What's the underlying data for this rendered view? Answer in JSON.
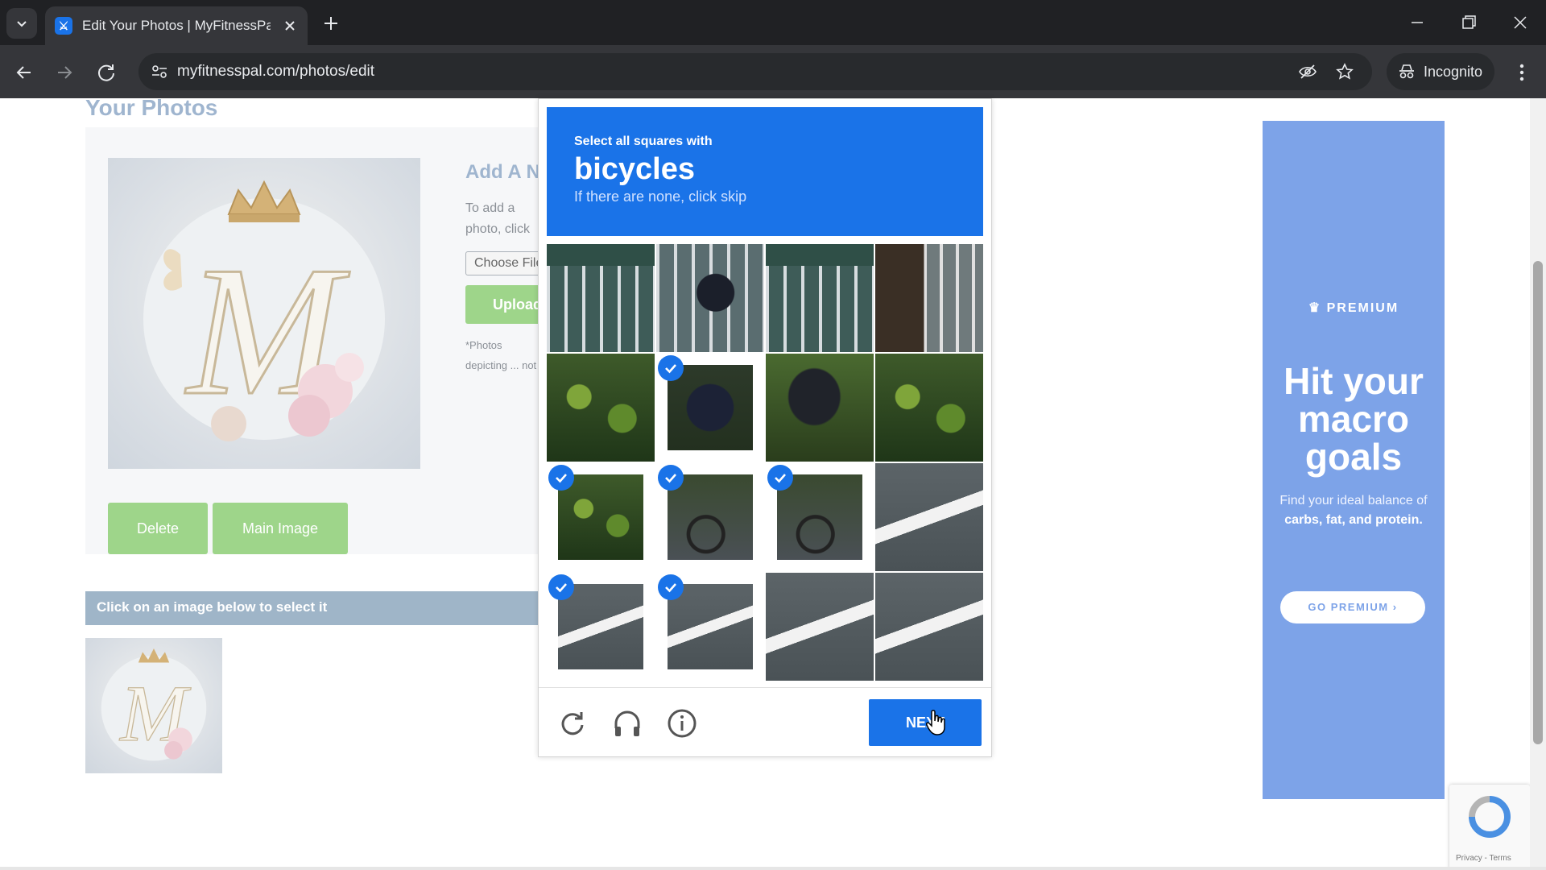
{
  "browser": {
    "tab_title": "Edit Your Photos | MyFitnessPal.com",
    "favicon_letter": "⚔",
    "url": "myfitnesspal.com/photos/edit",
    "incognito_label": "Incognito"
  },
  "page": {
    "title": "Your Photos",
    "add_heading": "Add A New Photo",
    "add_text": "To add a photo, click \"Upload\"",
    "choose_file_label": "Choose File",
    "upload_label": "Upload",
    "note": "*Photos depicting ... not allowed.",
    "delete_label": "Delete",
    "main_image_label": "Main Image",
    "select_bar": "Click on an image below to select it",
    "photo_monogram": "M"
  },
  "ad": {
    "premium_label": "PREMIUM",
    "headline": "Hit your macro goals",
    "sub_prefix": "Find your ideal balance of ",
    "sub_bold": "carbs, fat, and protein.",
    "button_label": "GO PREMIUM"
  },
  "recaptcha": {
    "links": "Privacy - Terms"
  },
  "captcha": {
    "instruction": "Select all squares with",
    "target": "bicycles",
    "hint": "If there are none, click skip",
    "next_label": "NEXT",
    "selected_tiles": [
      5,
      8,
      9,
      10,
      12,
      13
    ],
    "tiles": [
      "fence-top",
      "rider-head",
      "fence-top",
      "tree-fence",
      "hedge",
      "rider-back",
      "rider-bike",
      "hedge",
      "hedge",
      "bike-wheel",
      "bike-wheel",
      "road-line",
      "road-line",
      "road-line",
      "road-line",
      "road-line"
    ]
  }
}
